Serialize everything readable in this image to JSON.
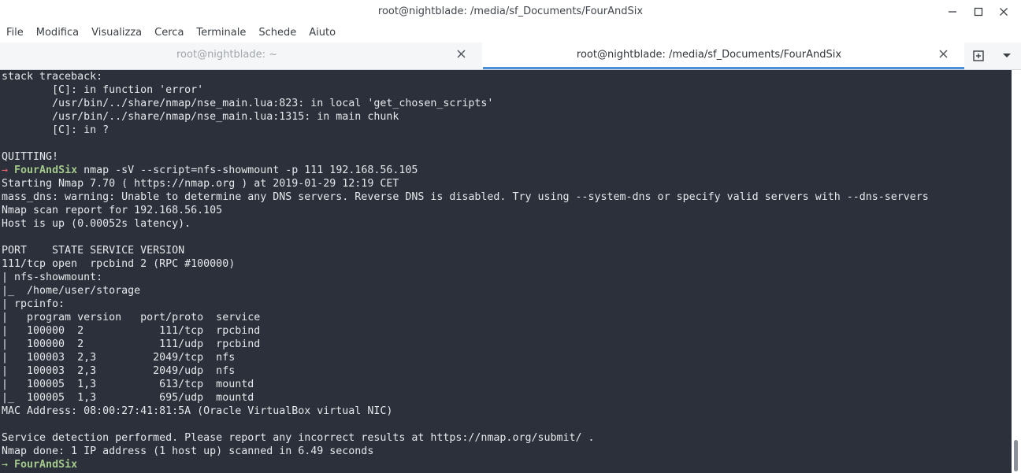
{
  "window": {
    "title": "root@nightblade: /media/sf_Documents/FourAndSix"
  },
  "menu": {
    "items": [
      "File",
      "Modifica",
      "Visualizza",
      "Cerca",
      "Terminale",
      "Schede",
      "Aiuto"
    ]
  },
  "tabs": [
    {
      "label": "root@nightblade: ~",
      "active": false
    },
    {
      "label": "root@nightblade: /media/sf_Documents/FourAndSix",
      "active": true
    }
  ],
  "colors": {
    "terminal_bg": "#2b303b",
    "terminal_fg": "#e6e8eb",
    "prompt_green": "#a3c98b",
    "prompt_red": "#e0616a",
    "tab_accent": "#4a90d9"
  },
  "terminal": {
    "lines": [
      {
        "text": "stack traceback:"
      },
      {
        "text": "        [C]: in function 'error'"
      },
      {
        "text": "        /usr/bin/../share/nmap/nse_main.lua:823: in local 'get_chosen_scripts'"
      },
      {
        "text": "        /usr/bin/../share/nmap/nse_main.lua:1315: in main chunk"
      },
      {
        "text": "        [C]: in ?"
      },
      {
        "text": ""
      },
      {
        "text": "QUITTING!"
      },
      {
        "prompt": {
          "arrow": "→",
          "status": "error",
          "dir": "FourAndSix",
          "command": " nmap -sV --script=nfs-showmount -p 111 192.168.56.105"
        }
      },
      {
        "text": "Starting Nmap 7.70 ( https://nmap.org ) at 2019-01-29 12:19 CET"
      },
      {
        "text": "mass_dns: warning: Unable to determine any DNS servers. Reverse DNS is disabled. Try using --system-dns or specify valid servers with --dns-servers"
      },
      {
        "text": "Nmap scan report for 192.168.56.105"
      },
      {
        "text": "Host is up (0.00052s latency)."
      },
      {
        "text": ""
      },
      {
        "text": "PORT    STATE SERVICE VERSION"
      },
      {
        "text": "111/tcp open  rpcbind 2 (RPC #100000)"
      },
      {
        "text": "| nfs-showmount:"
      },
      {
        "text": "|_  /home/user/storage"
      },
      {
        "text": "| rpcinfo:"
      },
      {
        "text": "|   program version   port/proto  service"
      },
      {
        "text": "|   100000  2            111/tcp  rpcbind"
      },
      {
        "text": "|   100000  2            111/udp  rpcbind"
      },
      {
        "text": "|   100003  2,3         2049/tcp  nfs"
      },
      {
        "text": "|   100003  2,3         2049/udp  nfs"
      },
      {
        "text": "|   100005  1,3          613/tcp  mountd"
      },
      {
        "text": "|_  100005  1,3          695/udp  mountd"
      },
      {
        "text": "MAC Address: 08:00:27:41:81:5A (Oracle VirtualBox virtual NIC)"
      },
      {
        "text": ""
      },
      {
        "text": "Service detection performed. Please report any incorrect results at https://nmap.org/submit/ ."
      },
      {
        "text": "Nmap done: 1 IP address (1 host up) scanned in 6.49 seconds"
      },
      {
        "prompt": {
          "arrow": "→",
          "status": "ok",
          "dir": "FourAndSix",
          "command": ""
        }
      }
    ]
  }
}
